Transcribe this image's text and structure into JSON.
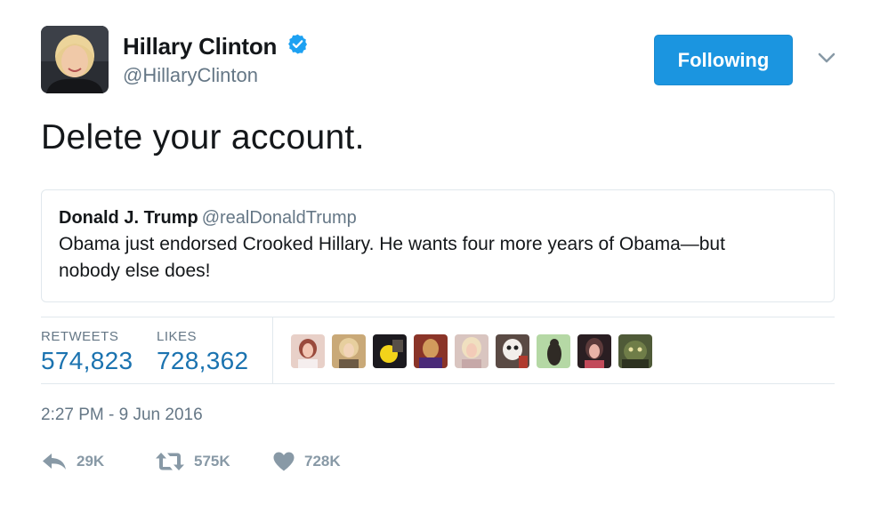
{
  "author": {
    "display_name": "Hillary Clinton",
    "handle": "@HillaryClinton",
    "verified": true
  },
  "follow_button": {
    "label": "Following"
  },
  "tweet": {
    "text": "Delete your account."
  },
  "quoted_tweet": {
    "author_name": "Donald J. Trump",
    "author_handle": "@realDonaldTrump",
    "text_line1": "Obama just endorsed Crooked Hillary. He wants four more years of Obama—but",
    "text_line2": "nobody else does!"
  },
  "stats": {
    "retweets_label": "RETWEETS",
    "retweets_value": "574,823",
    "likes_label": "LIKES",
    "likes_value": "728,362"
  },
  "timestamp": "2:27 PM - 9 Jun 2016",
  "actions": {
    "reply_count": "29K",
    "retweet_count": "575K",
    "like_count": "728K"
  },
  "colors": {
    "accent": "#1b95e0",
    "stat_value": "#1b73b0",
    "muted": "#657786",
    "border": "#e1e8ed"
  },
  "icons": [
    "verified-badge-icon",
    "chevron-down-icon",
    "reply-icon",
    "retweet-icon",
    "heart-icon"
  ]
}
